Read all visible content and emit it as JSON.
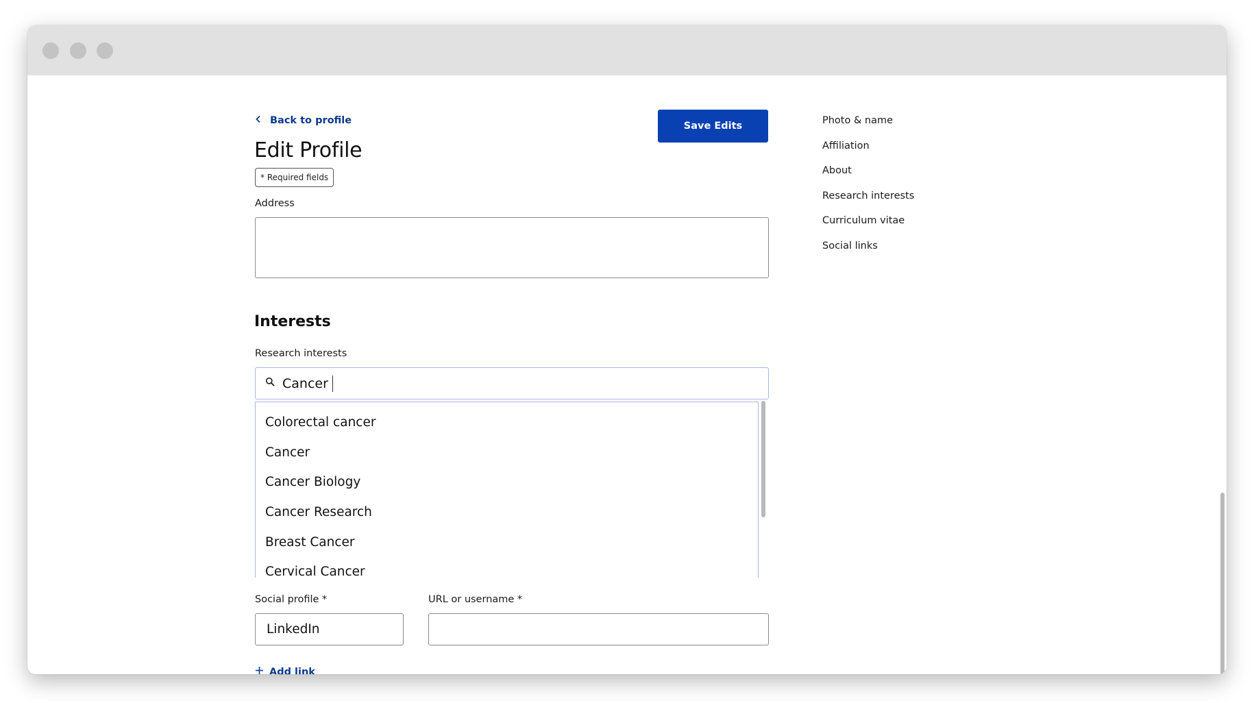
{
  "header": {
    "back_label": "Back to profile",
    "title": "Edit Profile",
    "required_note": "* Required fields",
    "save_label": "Save Edits"
  },
  "address": {
    "label": "Address",
    "value": ""
  },
  "interests": {
    "section_title": "Interests",
    "research_label": "Research interests",
    "search_value": "Cancer",
    "suggestions": [
      "Colorectal cancer",
      "Cancer",
      "Cancer Biology",
      "Cancer Research",
      "Breast Cancer",
      "Cervical Cancer"
    ]
  },
  "social": {
    "profile_label": "Social profile *",
    "profile_value": "LinkedIn",
    "url_label": "URL or username *",
    "url_value": "",
    "add_link_label": "Add link"
  },
  "side_nav": {
    "items": [
      "Photo & name",
      "Affiliation",
      "About",
      "Research interests",
      "Curriculum vitae",
      "Social links"
    ]
  },
  "colors": {
    "accent": "#0a41b2",
    "link": "#0c3a8e",
    "titlebar": "#e1e1e1"
  },
  "icons": {
    "back": "chevron-left-icon",
    "search": "search-icon",
    "add": "plus-icon"
  }
}
